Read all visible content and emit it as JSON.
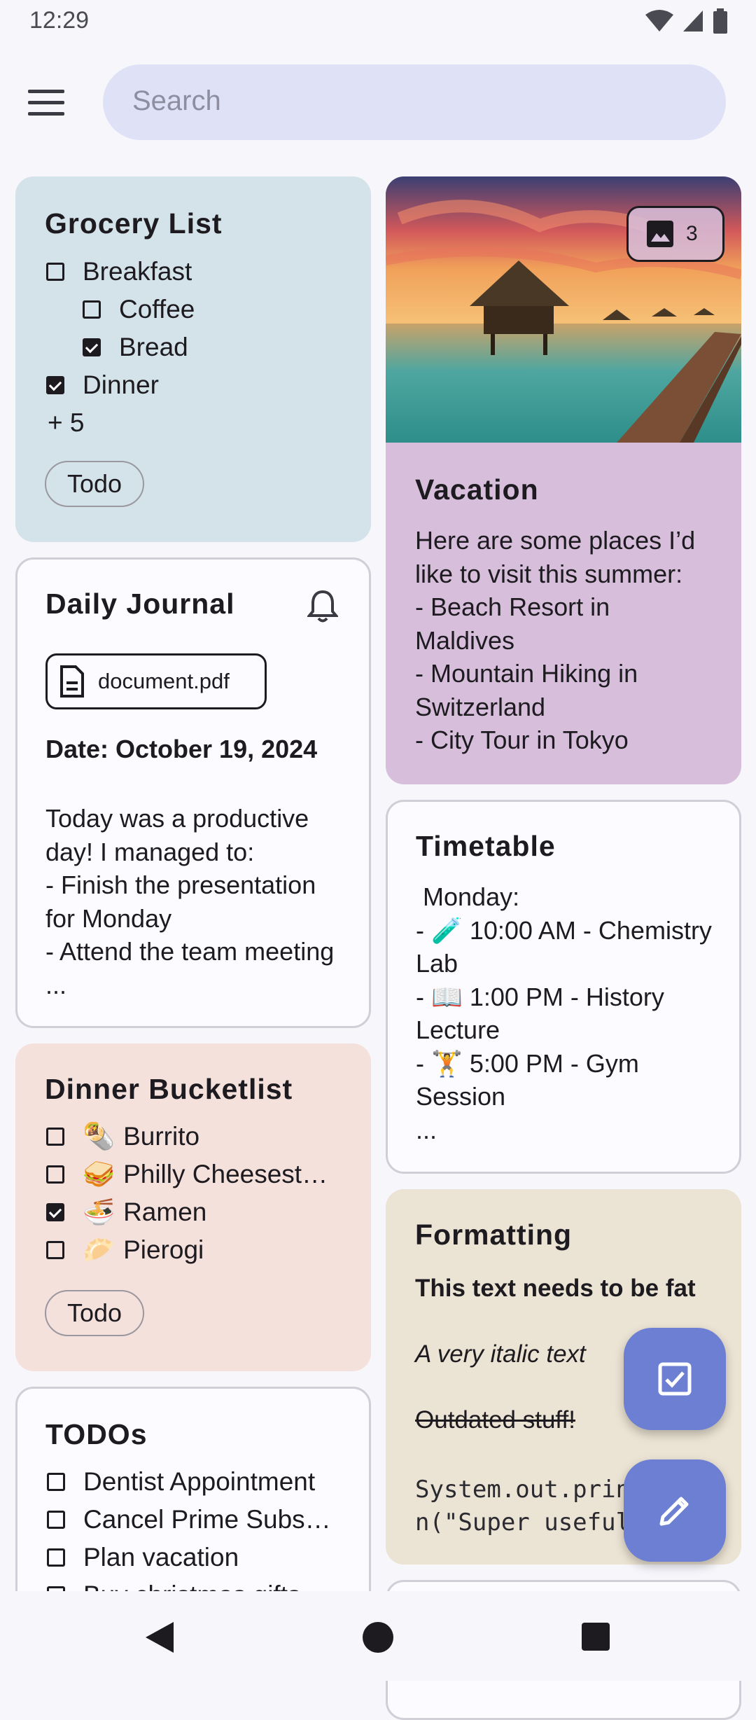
{
  "status": {
    "time": "12:29"
  },
  "search": {
    "placeholder": "Search"
  },
  "notes": {
    "grocery": {
      "title": "Grocery List",
      "items": [
        {
          "label": "Breakfast",
          "checked": false
        },
        {
          "label": "Coffee",
          "checked": false
        },
        {
          "label": "Bread",
          "checked": true
        },
        {
          "label": "Dinner",
          "checked": true
        }
      ],
      "more": "+ 5",
      "chip": "Todo",
      "color": "#d4e3e9"
    },
    "journal": {
      "title": "Daily Journal",
      "attachment": "document.pdf",
      "date_line": "Date: October 19, 2024",
      "body": "Today was a productive\nday! I managed to:\n- Finish the presentation\nfor Monday\n- Attend the team meeting\n..."
    },
    "dinner": {
      "title": "Dinner Bucketlist",
      "items": [
        {
          "emoji": "🌯",
          "label": "Burrito",
          "checked": false
        },
        {
          "emoji": "🥪",
          "label": "Philly Cheesest…",
          "checked": false
        },
        {
          "emoji": "🍜",
          "label": "Ramen",
          "checked": true
        },
        {
          "emoji": "🥟",
          "label": "Pierogi",
          "checked": false
        }
      ],
      "chip": "Todo",
      "color": "#f5e1dc"
    },
    "todos": {
      "title": "TODOs",
      "items": [
        {
          "label": "Dentist Appointment",
          "checked": false
        },
        {
          "label": "Cancel Prime Subs…",
          "checked": false
        },
        {
          "label": "Plan vacation",
          "checked": false
        },
        {
          "label": "Buy christmas gifts",
          "checked": false
        }
      ]
    },
    "vacation": {
      "title": "Vacation",
      "image_count": "3",
      "body": "Here are some places I’d\nlike to visit this summer:\n- Beach Resort in\nMaldives\n- Mountain Hiking in\nSwitzerland\n- City Tour in Tokyo",
      "color": "#d7bfdc"
    },
    "timetable": {
      "title": "Timetable",
      "body": " Monday:\n- 🧪 10:00 AM - Chemistry\nLab\n- 📖 1:00 PM - History\nLecture\n- 🏋 5:00 PM - Gym\nSession\n..."
    },
    "formatting": {
      "title": "Formatting",
      "bold": "This text needs to be fat",
      "italic": "A very italic text",
      "strike": "Outdated stuff!",
      "code": "System.out.printl\nn(\"Super useful",
      "color": "#ebe3d3"
    }
  },
  "fabs": {
    "todo_icon": "checkbox-icon",
    "note_icon": "pencil-icon",
    "accent": "#6c7fd3"
  },
  "nav": {
    "back_icon": "back-triangle-icon",
    "home_icon": "home-circle-icon",
    "recents_icon": "recents-square-icon"
  }
}
